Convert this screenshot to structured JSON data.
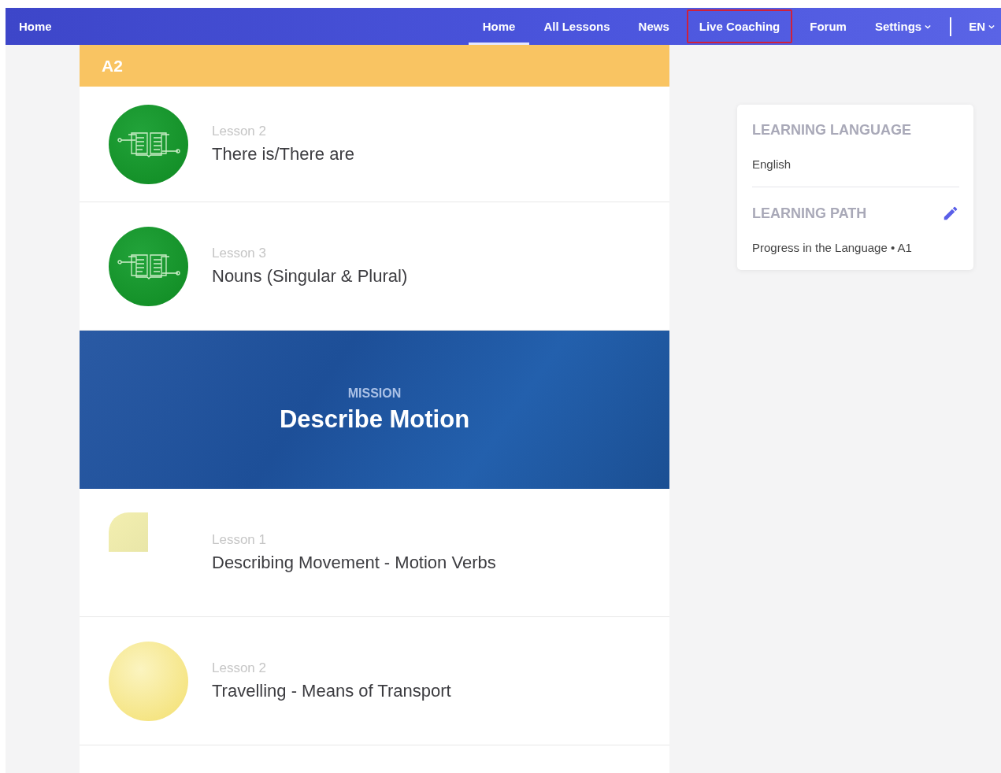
{
  "nav": {
    "brand": "Home",
    "items": [
      {
        "label": "Home",
        "selected": true,
        "highlighted": false,
        "caret": false
      },
      {
        "label": "All Lessons",
        "selected": false,
        "highlighted": false,
        "caret": false
      },
      {
        "label": "News",
        "selected": false,
        "highlighted": false,
        "caret": false
      },
      {
        "label": "Live Coaching",
        "selected": false,
        "highlighted": true,
        "caret": false
      },
      {
        "label": "Forum",
        "selected": false,
        "highlighted": false,
        "caret": false
      },
      {
        "label": "Settings",
        "selected": false,
        "highlighted": false,
        "caret": true
      }
    ],
    "language": "EN"
  },
  "level_header": "A2",
  "lessons": [
    {
      "kind": "lesson",
      "thumbnail": {
        "kind": "book"
      },
      "number": "Lesson 2",
      "title": "There is/There are"
    },
    {
      "kind": "lesson",
      "thumbnail": {
        "kind": "book"
      },
      "number": "Lesson 3",
      "title": "Nouns (Singular & Plural)"
    },
    {
      "kind": "mission",
      "label": "MISSION",
      "title": "Describe Motion"
    },
    {
      "kind": "lesson",
      "thumbnail": {
        "kind": "square"
      },
      "number": "Lesson 1",
      "title": "Describing Movement - Motion Verbs"
    },
    {
      "kind": "lesson",
      "thumbnail": {
        "kind": "round"
      },
      "number": "Lesson 2",
      "title": "Travelling - Means of Transport"
    }
  ],
  "sidebar": {
    "sections": [
      {
        "heading": "LEARNING LANGUAGE",
        "value": "English",
        "editable": false
      },
      {
        "heading": "LEARNING PATH",
        "value": "Progress in the Language • A1",
        "editable": true
      }
    ]
  }
}
